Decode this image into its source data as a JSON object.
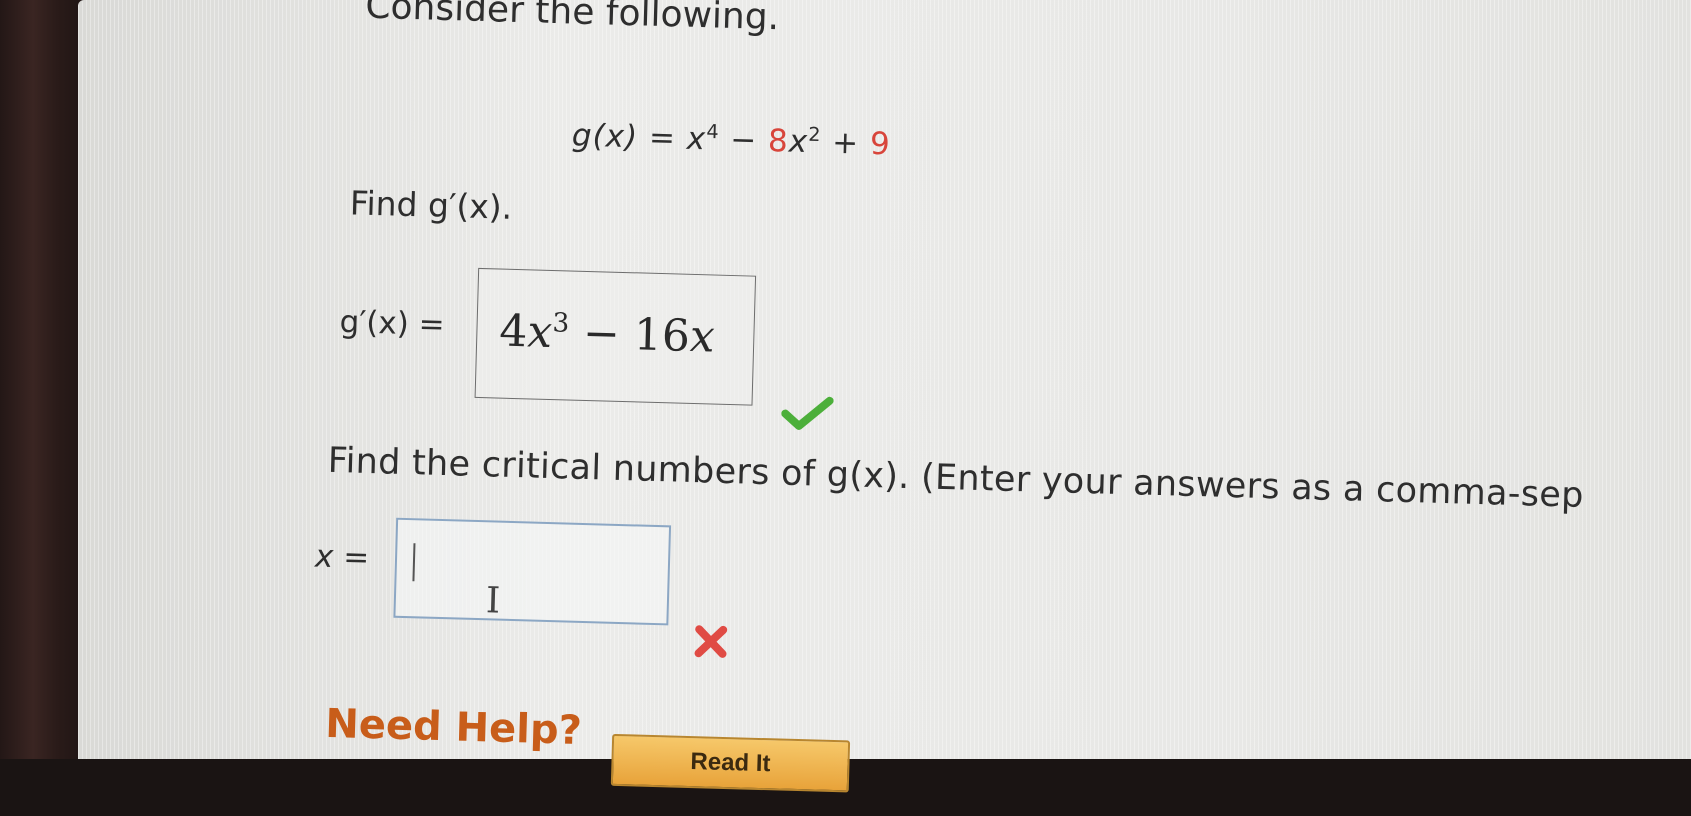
{
  "question": {
    "intro": "Consider the following.",
    "equation": {
      "lhs": "g(x)",
      "equals": "=",
      "term1_base": "x",
      "term1_exp": "4",
      "minus": "−",
      "term2_coef": "8",
      "term2_base": "x",
      "term2_exp": "2",
      "plus": "+",
      "constant": "9"
    },
    "part1": {
      "prompt": "Find g′(x).",
      "label": "g′(x) =",
      "answer": {
        "coef1": "4",
        "var1": "x",
        "exp1": "3",
        "op": "−",
        "coef2": "16",
        "var2": "x"
      },
      "status": "correct"
    },
    "part2": {
      "prompt": "Find the critical numbers of g(x). (Enter your answers as a comma-sep",
      "label": "x =",
      "input_value": "",
      "status": "incorrect"
    }
  },
  "help": {
    "label": "Need Help?",
    "read_button": "Read It"
  },
  "colors": {
    "correct": "#4caf3a",
    "incorrect": "#e04b44",
    "help_text": "#c85d1a",
    "red_term": "#d8453b"
  },
  "icons": [
    "check-icon",
    "cross-icon",
    "text-cursor-icon"
  ]
}
